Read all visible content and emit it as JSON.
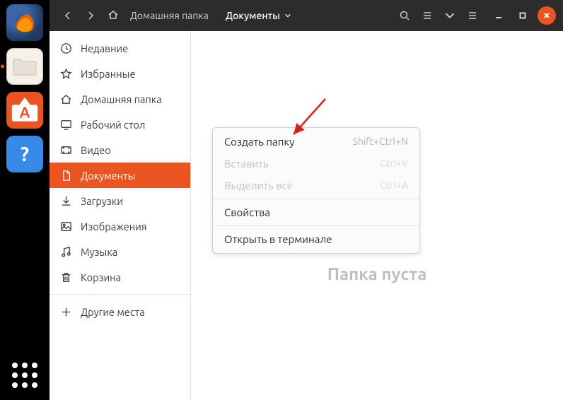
{
  "launcher": {
    "items": [
      "firefox",
      "files",
      "software",
      "help"
    ]
  },
  "titlebar": {
    "breadcrumb_home": "Домашняя папка",
    "breadcrumb_current": "Документы"
  },
  "sidebar": {
    "items": [
      {
        "label": "Недавние"
      },
      {
        "label": "Избранные"
      },
      {
        "label": "Домашняя папка"
      },
      {
        "label": "Рабочий стол"
      },
      {
        "label": "Видео"
      },
      {
        "label": "Документы"
      },
      {
        "label": "Загрузки"
      },
      {
        "label": "Изображения"
      },
      {
        "label": "Музыка"
      },
      {
        "label": "Корзина"
      }
    ],
    "other_places": "Другие места",
    "active_index": 5
  },
  "content": {
    "empty_label": "Папка пуста"
  },
  "context_menu": {
    "items": [
      {
        "label": "Создать папку",
        "accel": "Shift+Ctrl+N",
        "enabled": true
      },
      {
        "label": "Вставить",
        "accel": "Ctrl+V",
        "enabled": false
      },
      {
        "label": "Выделить всё",
        "accel": "Ctrl+A",
        "enabled": false
      },
      {
        "sep": true
      },
      {
        "label": "Свойства",
        "accel": "",
        "enabled": true
      },
      {
        "sep": true
      },
      {
        "label": "Открыть в терминале",
        "accel": "",
        "enabled": true
      }
    ]
  }
}
